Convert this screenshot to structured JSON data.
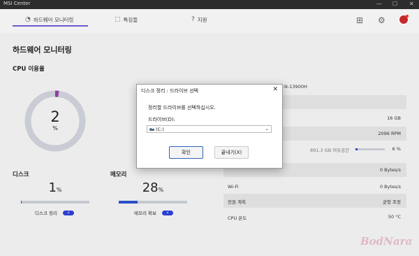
{
  "window": {
    "title": "MSI Center",
    "minimize": "—",
    "maximize": "☐",
    "close": "✕"
  },
  "tabs": [
    {
      "label": "하드웨어 모니터링",
      "icon": "◔"
    },
    {
      "label": "특징들",
      "icon": "⬚"
    },
    {
      "label": "지원",
      "icon": "?"
    }
  ],
  "header_icons": {
    "grid": "⊞",
    "settings": "⚙"
  },
  "page_title": "하드웨어 모니터링",
  "cpu": {
    "label": "CPU 이용율",
    "value": "2",
    "unit": "%",
    "percent": 2
  },
  "disk": {
    "label": "디스크",
    "value": "1",
    "unit": "%",
    "percent": 1,
    "action_label": "디스크 정리",
    "action_icon": "⚡"
  },
  "memory": {
    "label": "메모리",
    "value": "28",
    "unit": "%",
    "percent": 28,
    "action_label": "메모리 확보",
    "action_icon": "⚡"
  },
  "system_panel": {
    "cpu_name": "i9-13900H",
    "rows": [
      {
        "key": "",
        "value": ""
      },
      {
        "key": "",
        "value": "16 GB"
      },
      {
        "key": "",
        "value": "2096 RPM"
      },
      {
        "key": "",
        "disk_caption": "891.3 GB 여유공간",
        "value": "6 %",
        "disk_fill_percent": 6
      },
      {
        "key": "",
        "value": "0 Bytes/s"
      },
      {
        "key": "Wi-Fi",
        "value": "0 Bytes/s"
      },
      {
        "key": "전원 계획",
        "value": "균형 조정"
      },
      {
        "key": "CPU 온도",
        "value": "50 °C"
      }
    ]
  },
  "dialog": {
    "title": "디스크 정리 : 드라이브 선택",
    "close": "✕",
    "message": "정리할 드라이브를 선택하십시오.",
    "drive_label": "드라이브(D):",
    "drive_value": "(C:)",
    "ok_label": "확인",
    "cancel_label": "끝내기(X)"
  },
  "watermark": "BodNara",
  "colors": {
    "accent": "#6a5acd",
    "bar_fill": "#2b4fc7",
    "donut_track": "#c9ccd4",
    "donut_fill": "#8e3fa0"
  }
}
